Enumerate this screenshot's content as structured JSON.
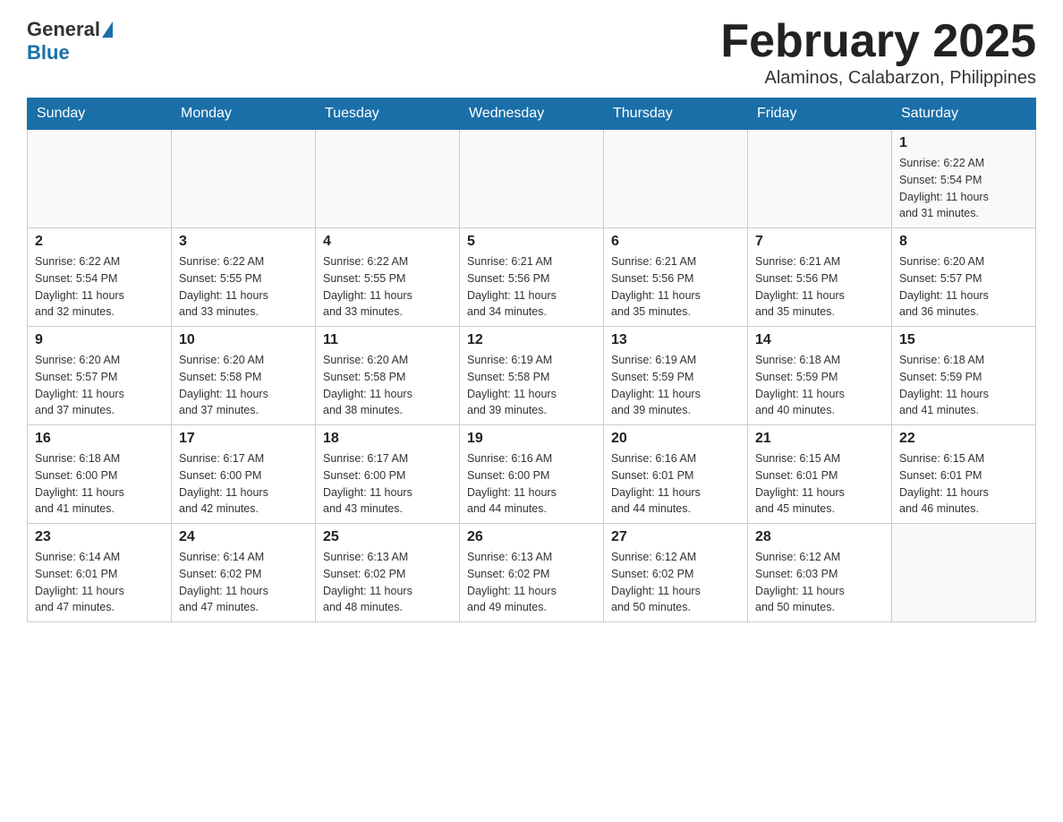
{
  "header": {
    "logo_general": "General",
    "logo_blue": "Blue",
    "month_title": "February 2025",
    "subtitle": "Alaminos, Calabarzon, Philippines"
  },
  "days_of_week": [
    "Sunday",
    "Monday",
    "Tuesday",
    "Wednesday",
    "Thursday",
    "Friday",
    "Saturday"
  ],
  "weeks": [
    {
      "days": [
        {
          "number": "",
          "info": ""
        },
        {
          "number": "",
          "info": ""
        },
        {
          "number": "",
          "info": ""
        },
        {
          "number": "",
          "info": ""
        },
        {
          "number": "",
          "info": ""
        },
        {
          "number": "",
          "info": ""
        },
        {
          "number": "1",
          "info": "Sunrise: 6:22 AM\nSunset: 5:54 PM\nDaylight: 11 hours\nand 31 minutes."
        }
      ]
    },
    {
      "days": [
        {
          "number": "2",
          "info": "Sunrise: 6:22 AM\nSunset: 5:54 PM\nDaylight: 11 hours\nand 32 minutes."
        },
        {
          "number": "3",
          "info": "Sunrise: 6:22 AM\nSunset: 5:55 PM\nDaylight: 11 hours\nand 33 minutes."
        },
        {
          "number": "4",
          "info": "Sunrise: 6:22 AM\nSunset: 5:55 PM\nDaylight: 11 hours\nand 33 minutes."
        },
        {
          "number": "5",
          "info": "Sunrise: 6:21 AM\nSunset: 5:56 PM\nDaylight: 11 hours\nand 34 minutes."
        },
        {
          "number": "6",
          "info": "Sunrise: 6:21 AM\nSunset: 5:56 PM\nDaylight: 11 hours\nand 35 minutes."
        },
        {
          "number": "7",
          "info": "Sunrise: 6:21 AM\nSunset: 5:56 PM\nDaylight: 11 hours\nand 35 minutes."
        },
        {
          "number": "8",
          "info": "Sunrise: 6:20 AM\nSunset: 5:57 PM\nDaylight: 11 hours\nand 36 minutes."
        }
      ]
    },
    {
      "days": [
        {
          "number": "9",
          "info": "Sunrise: 6:20 AM\nSunset: 5:57 PM\nDaylight: 11 hours\nand 37 minutes."
        },
        {
          "number": "10",
          "info": "Sunrise: 6:20 AM\nSunset: 5:58 PM\nDaylight: 11 hours\nand 37 minutes."
        },
        {
          "number": "11",
          "info": "Sunrise: 6:20 AM\nSunset: 5:58 PM\nDaylight: 11 hours\nand 38 minutes."
        },
        {
          "number": "12",
          "info": "Sunrise: 6:19 AM\nSunset: 5:58 PM\nDaylight: 11 hours\nand 39 minutes."
        },
        {
          "number": "13",
          "info": "Sunrise: 6:19 AM\nSunset: 5:59 PM\nDaylight: 11 hours\nand 39 minutes."
        },
        {
          "number": "14",
          "info": "Sunrise: 6:18 AM\nSunset: 5:59 PM\nDaylight: 11 hours\nand 40 minutes."
        },
        {
          "number": "15",
          "info": "Sunrise: 6:18 AM\nSunset: 5:59 PM\nDaylight: 11 hours\nand 41 minutes."
        }
      ]
    },
    {
      "days": [
        {
          "number": "16",
          "info": "Sunrise: 6:18 AM\nSunset: 6:00 PM\nDaylight: 11 hours\nand 41 minutes."
        },
        {
          "number": "17",
          "info": "Sunrise: 6:17 AM\nSunset: 6:00 PM\nDaylight: 11 hours\nand 42 minutes."
        },
        {
          "number": "18",
          "info": "Sunrise: 6:17 AM\nSunset: 6:00 PM\nDaylight: 11 hours\nand 43 minutes."
        },
        {
          "number": "19",
          "info": "Sunrise: 6:16 AM\nSunset: 6:00 PM\nDaylight: 11 hours\nand 44 minutes."
        },
        {
          "number": "20",
          "info": "Sunrise: 6:16 AM\nSunset: 6:01 PM\nDaylight: 11 hours\nand 44 minutes."
        },
        {
          "number": "21",
          "info": "Sunrise: 6:15 AM\nSunset: 6:01 PM\nDaylight: 11 hours\nand 45 minutes."
        },
        {
          "number": "22",
          "info": "Sunrise: 6:15 AM\nSunset: 6:01 PM\nDaylight: 11 hours\nand 46 minutes."
        }
      ]
    },
    {
      "days": [
        {
          "number": "23",
          "info": "Sunrise: 6:14 AM\nSunset: 6:01 PM\nDaylight: 11 hours\nand 47 minutes."
        },
        {
          "number": "24",
          "info": "Sunrise: 6:14 AM\nSunset: 6:02 PM\nDaylight: 11 hours\nand 47 minutes."
        },
        {
          "number": "25",
          "info": "Sunrise: 6:13 AM\nSunset: 6:02 PM\nDaylight: 11 hours\nand 48 minutes."
        },
        {
          "number": "26",
          "info": "Sunrise: 6:13 AM\nSunset: 6:02 PM\nDaylight: 11 hours\nand 49 minutes."
        },
        {
          "number": "27",
          "info": "Sunrise: 6:12 AM\nSunset: 6:02 PM\nDaylight: 11 hours\nand 50 minutes."
        },
        {
          "number": "28",
          "info": "Sunrise: 6:12 AM\nSunset: 6:03 PM\nDaylight: 11 hours\nand 50 minutes."
        },
        {
          "number": "",
          "info": ""
        }
      ]
    }
  ]
}
